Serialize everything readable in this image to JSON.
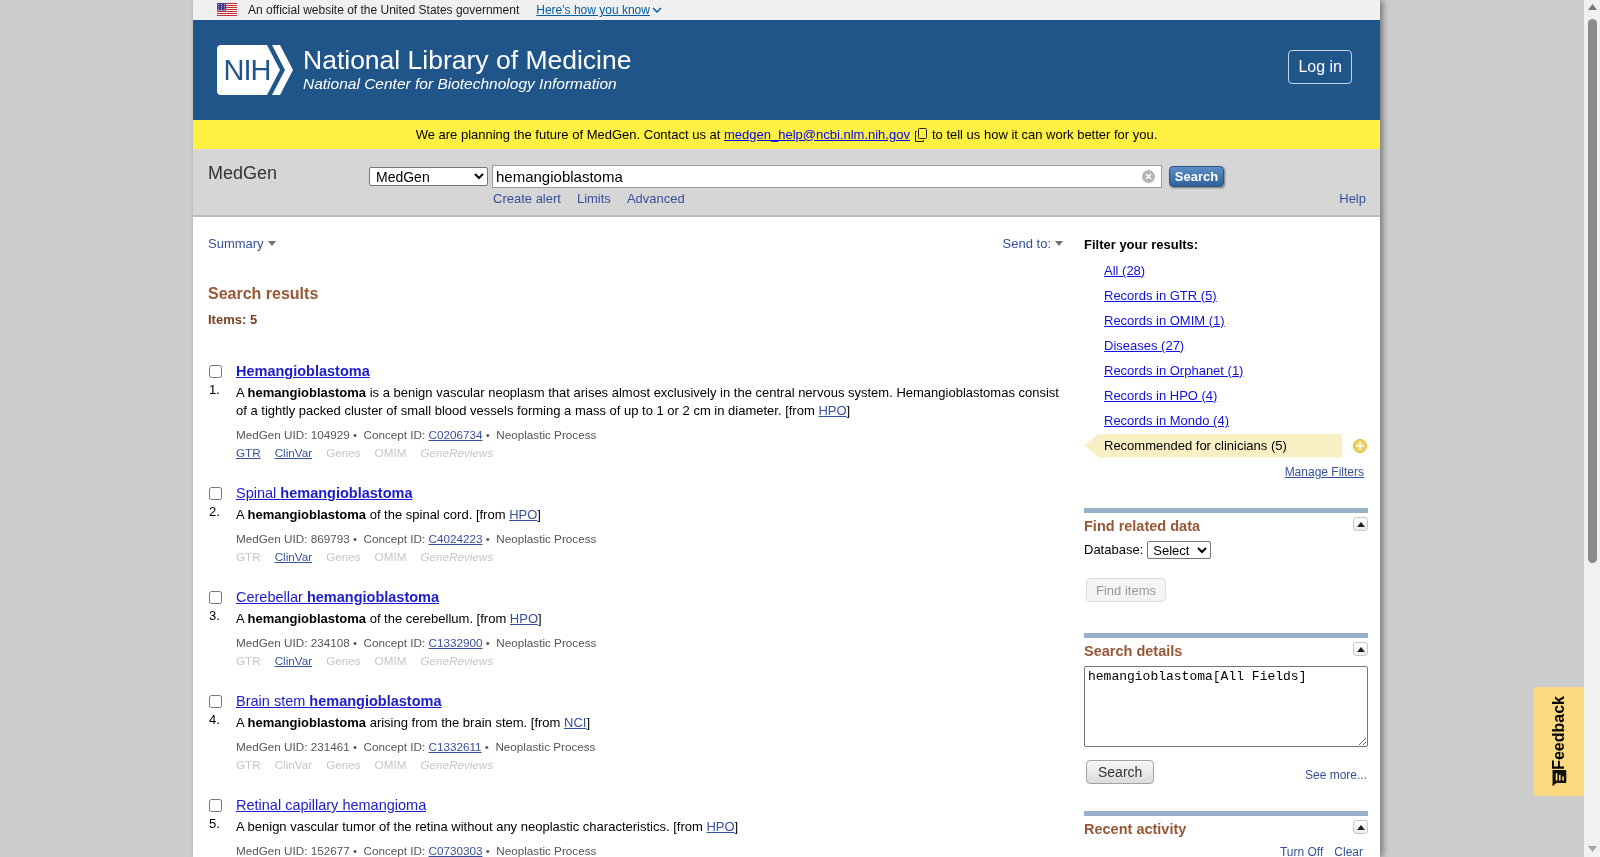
{
  "gov_banner": {
    "text": "An official website of the United States government",
    "link": "Here's how you know"
  },
  "header": {
    "logo_text": "NIH",
    "title": "National Library of Medicine",
    "subtitle": "National Center for Biotechnology Information",
    "login_button": "Log in"
  },
  "notice": {
    "text": "We are planning the future of MedGen. Contact us at",
    "email": "medgen_help@ncbi.nlm.nih.gov",
    "text_after": "to tell us how it can work better for you."
  },
  "search_bar": {
    "database_name": "MedGen",
    "database_select": "MedGen",
    "query": "hemangioblastoma",
    "search_button": "Search",
    "links": [
      "Create alert",
      "Limits",
      "Advanced"
    ],
    "help_link": "Help"
  },
  "results_toolbar": {
    "format_menu": "Summary",
    "send_to_menu": "Send to:"
  },
  "results": {
    "heading": "Search results",
    "count": "Items: 5",
    "items": [
      {
        "number": "1.",
        "checked": false,
        "title": "**Hemangioblastoma**",
        "description": "A **hemangioblastoma** is a benign vascular neoplasm that arises almost exclusively in the central nervous system. Hemangioblastomas consist of a tightly packed cluster of small blood vessels forming a mass of up to 1 or 2 cm in diameter. [from",
        "source": "HPO",
        "source_close": "]",
        "uid": "MedGen UID: 104929 •  Concept ID:",
        "concept_id": "C0206734",
        "semantic_type": "•  Neoplastic Process",
        "links": [
          {
            "label": "GTR",
            "disabled": false,
            "italic": false
          },
          {
            "label": "ClinVar",
            "disabled": false,
            "italic": false
          },
          {
            "label": "Genes",
            "disabled": true,
            "italic": false
          },
          {
            "label": "OMIM",
            "disabled": true,
            "italic": false
          },
          {
            "label": "GeneReviews",
            "disabled": true,
            "italic": true
          }
        ]
      },
      {
        "number": "2.",
        "checked": false,
        "title": "Spinal **hemangioblastoma**",
        "description": "A **hemangioblastoma** of the spinal cord. [from",
        "source": "HPO",
        "source_close": "]",
        "uid": "MedGen UID: 869793 •  Concept ID:",
        "concept_id": "C4024223",
        "semantic_type": "•  Neoplastic Process",
        "links": [
          {
            "label": "GTR",
            "disabled": true,
            "italic": false
          },
          {
            "label": "ClinVar",
            "disabled": false,
            "italic": false
          },
          {
            "label": "Genes",
            "disabled": true,
            "italic": false
          },
          {
            "label": "OMIM",
            "disabled": true,
            "italic": false
          },
          {
            "label": "GeneReviews",
            "disabled": true,
            "italic": true
          }
        ]
      },
      {
        "number": "3.",
        "checked": false,
        "title": "Cerebellar **hemangioblastoma**",
        "description": "A **hemangioblastoma** of the cerebellum. [from",
        "source": "HPO",
        "source_close": "]",
        "uid": "MedGen UID: 234108 •  Concept ID:",
        "concept_id": "C1332900",
        "semantic_type": "•  Neoplastic Process",
        "links": [
          {
            "label": "GTR",
            "disabled": true,
            "italic": false
          },
          {
            "label": "ClinVar",
            "disabled": false,
            "italic": false
          },
          {
            "label": "Genes",
            "disabled": true,
            "italic": false
          },
          {
            "label": "OMIM",
            "disabled": true,
            "italic": false
          },
          {
            "label": "GeneReviews",
            "disabled": true,
            "italic": true
          }
        ]
      },
      {
        "number": "4.",
        "checked": false,
        "title": "Brain stem **hemangioblastoma**",
        "description": "A **hemangioblastoma** arising from the brain stem. [from",
        "source": "NCI",
        "source_close": "]",
        "uid": "MedGen UID: 231461 •  Concept ID:",
        "concept_id": "C1332611",
        "semantic_type": "•  Neoplastic Process",
        "links": [
          {
            "label": "GTR",
            "disabled": true,
            "italic": false
          },
          {
            "label": "ClinVar",
            "disabled": true,
            "italic": false
          },
          {
            "label": "Genes",
            "disabled": true,
            "italic": false
          },
          {
            "label": "OMIM",
            "disabled": true,
            "italic": false
          },
          {
            "label": "GeneReviews",
            "disabled": true,
            "italic": true
          }
        ]
      },
      {
        "number": "5.",
        "checked": false,
        "title": "Retinal capillary hemangioma",
        "description": "A benign vascular tumor of the retina without any neoplastic characteristics. [from",
        "source": "HPO",
        "source_close": "]",
        "uid": "MedGen UID: 152677 •  Concept ID:",
        "concept_id": "C0730303",
        "semantic_type": "•  Neoplastic Process"
      }
    ]
  },
  "sidebar": {
    "filters": {
      "heading": "Filter your results:",
      "items": [
        {
          "label": "All (28)",
          "selected": false
        },
        {
          "label": "Records in GTR (5)",
          "selected": false
        },
        {
          "label": "Records in OMIM (1)",
          "selected": false
        },
        {
          "label": "Diseases (27)",
          "selected": false
        },
        {
          "label": "Records in Orphanet (1)",
          "selected": false
        },
        {
          "label": "Records in HPO (4)",
          "selected": false
        },
        {
          "label": "Records in Mondo (4)",
          "selected": false
        },
        {
          "label": "Recommended for clinicians (5)",
          "selected": true
        }
      ],
      "manage_link": "Manage Filters"
    },
    "find_related_data": {
      "title": "Find related data",
      "expanded": true,
      "database_label": "Database:",
      "database_select": "Select",
      "button": {
        "label": "Find items",
        "disabled": true
      }
    },
    "search_details": {
      "title": "Search details",
      "expanded": true,
      "query": "hemangioblastoma[All Fields]",
      "search_button": "Search",
      "see_more_link": "See more..."
    },
    "recent_activity": {
      "title": "Recent activity",
      "expanded": true,
      "links": [
        "Turn Off",
        "Clear"
      ]
    }
  },
  "feedback_button": "Feedback"
}
